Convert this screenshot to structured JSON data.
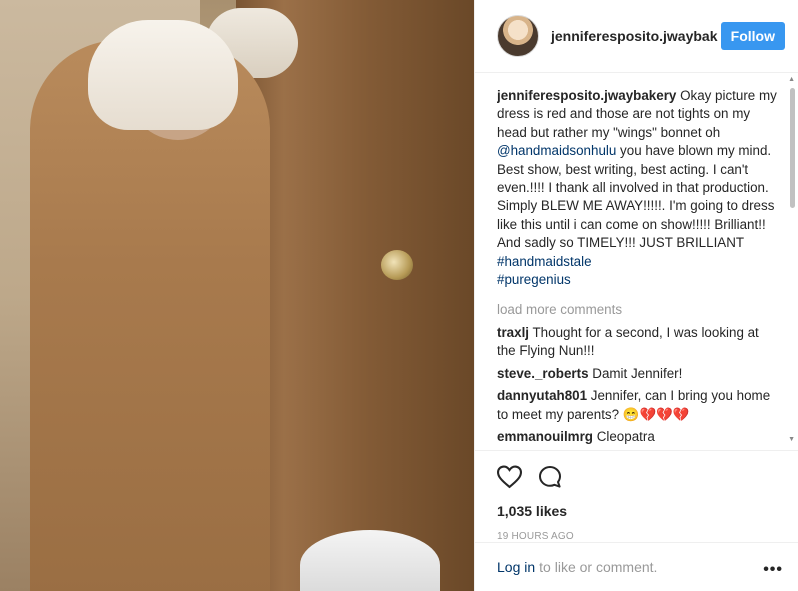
{
  "post": {
    "username": "jenniferesposito.jwaybak",
    "follow_label": "Follow"
  },
  "caption": {
    "author": "jenniferesposito.jwaybakery",
    "text_1": " Okay picture my dress is red and those are not tights on my head but rather my \"wings\" bonnet oh ",
    "mention": "@handmaidsonhulu",
    "text_2": " you have blown my mind. Best show, best writing, best acting. I can't even.!!!! I thank all involved in that production. Simply BLEW ME AWAY!!!!!. I'm going to dress like this until i can come on show!!!!! Brilliant!! And sadly so TIMELY!!! JUST BRILLIANT ",
    "hashtag_1": "#handmaidstale",
    "hashtag_2": "#puregenius"
  },
  "load_more": "load more comments",
  "comments": [
    {
      "author": "traxlj",
      "text": " Thought for a second, I was looking at the Flying Nun!!!"
    },
    {
      "author": "steve._roberts",
      "text": " Damit Jennifer!"
    },
    {
      "author": "dannyutah801",
      "text": " Jennifer, can I bring you home to meet my parents? 😁💔💔💔"
    },
    {
      "author": "emmanouilmrg",
      "text": " Cleopatra"
    }
  ],
  "likes": "1,035 likes",
  "time": "19 HOURS AGO",
  "footer": {
    "login_label": "Log in",
    "rest": "to like or comment.",
    "more": "•••"
  },
  "icons": {
    "like": "heart-icon",
    "comment": "comment-icon",
    "options": "more-options-icon"
  }
}
